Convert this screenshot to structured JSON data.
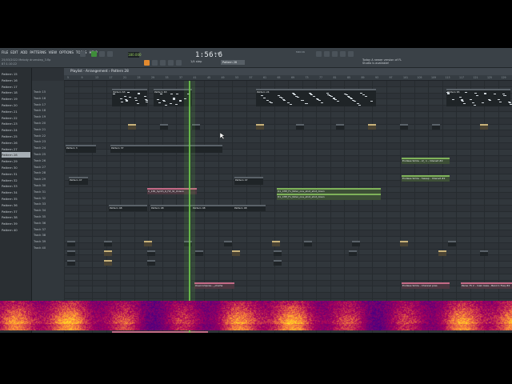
{
  "menu": [
    "FILE",
    "EDIT",
    "ADD",
    "PATTERNS",
    "VIEW",
    "OPTIONS",
    "TOOLS",
    "HELP"
  ],
  "hint_line1": "25/03/2022 Melody drumstep_3.flp",
  "hint_line2": "87:1:10:22",
  "transport": {
    "tempo": "180.000",
    "time": "1:56:6",
    "time_sub": "B:S:T"
  },
  "snap_label": "1/4 step",
  "pattern_selector": "Pattern 28",
  "cpu_label": "MIDI IN",
  "news": "Today  A newer version of FL Studio is available!",
  "playlist_title": "Playlist - Arrangement › Pattern 28",
  "ruler_numbers": [
    "5",
    "9",
    "13",
    "17",
    "21",
    "25",
    "29",
    "33",
    "37",
    "41",
    "45",
    "49",
    "53",
    "57",
    "61",
    "65",
    "69",
    "73",
    "77",
    "81",
    "85",
    "89",
    "93",
    "97",
    "101",
    "105",
    "109",
    "113",
    "117",
    "121",
    "125",
    "129"
  ],
  "channels": [
    "Pattern 15",
    "Pattern 16",
    "Pattern 17",
    "Pattern 18",
    "Pattern 19",
    "Pattern 20",
    "Pattern 21",
    "Pattern 22",
    "Pattern 23",
    "Pattern 24",
    "Pattern 25",
    "Pattern 26",
    "Pattern 27",
    "Pattern 28",
    "Pattern 29",
    "Pattern 30",
    "Pattern 31",
    "Pattern 32",
    "Pattern 33",
    "Pattern 34",
    "Pattern 35",
    "Pattern 36",
    "Pattern 37",
    "Pattern 38",
    "Pattern 39",
    "Pattern 40"
  ],
  "selected_channel": "Pattern 28",
  "tracks": [
    "Track 15",
    "Track 16",
    "Track 17",
    "Track 18",
    "Track 19",
    "Track 20",
    "Track 21",
    "Track 22",
    "Track 23",
    "Track 24",
    "Track 25",
    "Track 26",
    "Track 27",
    "Track 28",
    "Track 29",
    "Track 30",
    "Track 31",
    "Track 32",
    "Track 33",
    "Track 34",
    "Track 35",
    "Track 36",
    "Track 37",
    "Track 38",
    "Track 39",
    "Track 40"
  ],
  "clips": [
    {
      "label": "Pattern 63",
      "style": "dark"
    },
    {
      "label": "Pattern 63",
      "style": "dark"
    },
    {
      "label": "Pattern 24",
      "style": "dark"
    },
    {
      "label": "Pattern 65",
      "style": "dark"
    },
    {
      "label": "Pattern 3",
      "style": "dark"
    },
    {
      "label": "Pattern 37",
      "style": "dark"
    },
    {
      "label": "Pattern 47",
      "style": "dark"
    },
    {
      "label": "Pattern 47",
      "style": "dark"
    },
    {
      "label": "Endless Smile - Lf_ 1 - Intensit #2",
      "style": "green"
    },
    {
      "label": "Endless Smile - Sweep - Intensit #2",
      "style": "green"
    },
    {
      "label": "C_136_Synth_6_F#_St_Unison",
      "style": "pink"
    },
    {
      "label": "D1_CHP_Fx_faller_one_shot_shot_down",
      "style": "green"
    },
    {
      "label": "D1_CHP_Fx_faller_one_shot_shot_down",
      "style": "green"
    },
    {
      "label": "Pattern 48",
      "style": "dark"
    },
    {
      "label": "Pattern 48",
      "style": "dark"
    },
    {
      "label": "Pattern 48",
      "style": "dark"
    },
    {
      "label": "Pattern 48",
      "style": "dark"
    },
    {
      "label": "Overcompres..._ohwha",
      "style": "pink"
    },
    {
      "label": "Endless Smile - Channel pres",
      "style": "pink"
    },
    {
      "label": "Parse 75 2 - main bass - Band 1 Freq #2",
      "style": "pink"
    },
    {
      "label": "Vibe - Macro 1",
      "style": "purple"
    },
    {
      "label": "Endless Smile - St_ preset mood - Intensit #2",
      "style": "green"
    },
    {
      "label": "Fuel_SFP_project_vocal_chop_Fx_195_Em - Volume multiplier #2",
      "style": "pink"
    }
  ],
  "colors": {
    "playhead": "#6ecb4c",
    "accent": "#e28a2f"
  }
}
